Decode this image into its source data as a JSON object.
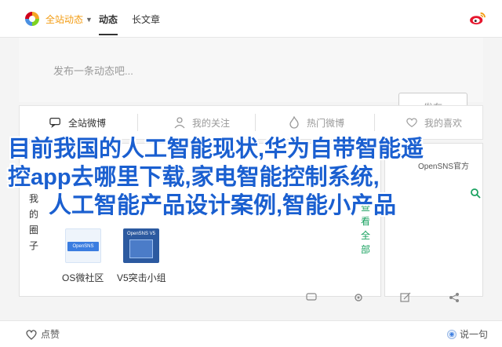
{
  "header": {
    "site_dropdown": "全站动态",
    "tabs": [
      "动态",
      "长文章"
    ]
  },
  "compose": {
    "placeholder": "发布一条动态吧...",
    "publish_label": "发布"
  },
  "filters": {
    "items": [
      "全站微博",
      "我的关注",
      "热门微博",
      "我的喜欢"
    ]
  },
  "overlay": {
    "line1": "目前我国的人工智能现状,华为自带智能遥",
    "line2": "控app去哪里下载,家电智能控制系统,",
    "line3": "人工智能产品设计案例,智能小产品"
  },
  "card": {
    "vertical_label": [
      "我",
      "的",
      "圈",
      "子"
    ],
    "thumbs": [
      {
        "badge": "OpenSNS",
        "label": "OS微社区"
      },
      {
        "caption": "OpenSNS V5",
        "label": "V5突击小组"
      }
    ]
  },
  "side": {
    "header": "OpenSNS官方",
    "vertical": [
      "查",
      "看",
      "全",
      "部"
    ]
  },
  "footer": {
    "like_label": "点赞",
    "say_label": "说一句"
  },
  "colors": {
    "accent": "#f39c12",
    "overlay_blue": "#1a5fd0",
    "green": "#1aa260"
  }
}
